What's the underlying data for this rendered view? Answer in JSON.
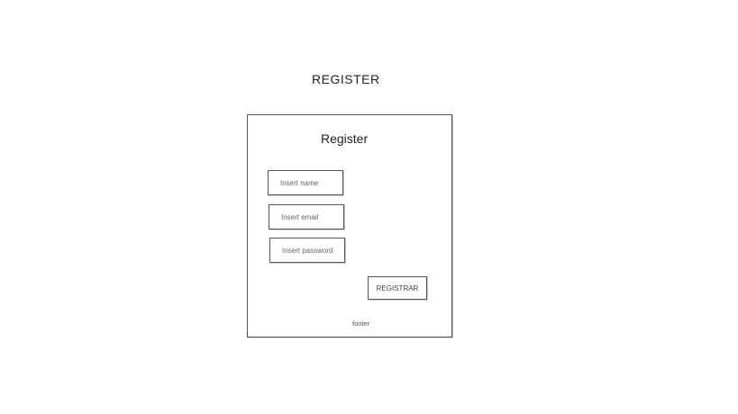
{
  "page": {
    "heading": "REGISTER"
  },
  "form": {
    "title": "Register",
    "fields": {
      "name": {
        "placeholder": "Insert name",
        "value": ""
      },
      "email": {
        "placeholder": "Insert email",
        "value": ""
      },
      "password": {
        "placeholder": "Insert password",
        "value": ""
      }
    },
    "submit_label": "REGISTRAR",
    "footer": "footer"
  }
}
